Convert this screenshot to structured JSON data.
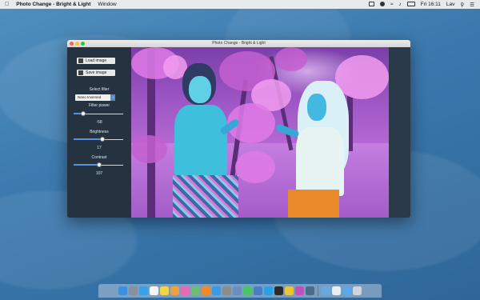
{
  "menubar": {
    "apple_icon": "apple-icon",
    "app_name": "Photo Change - Bright & Light",
    "menus": [
      "Window"
    ],
    "clock": "Fri 16:11",
    "user": "Lav"
  },
  "window": {
    "title": "Photo Change - Bright & Light"
  },
  "sidebar": {
    "load_label": "Load image",
    "save_label": "Save image",
    "select_filter_label": "Select filter",
    "filter_value": "Nano Inversed",
    "filter_power_label": "Filter power",
    "filter_power_value": "-58",
    "filter_power_level": 0.2,
    "brightness_label": "Brightness",
    "brightness_value": "17",
    "brightness_level": 0.58,
    "contrast_label": "Contrast",
    "contrast_value": "107",
    "contrast_level": 0.52
  },
  "dock": {
    "icons": [
      {
        "name": "finder-icon",
        "color": "#3f8fe0"
      },
      {
        "name": "launchpad-icon",
        "color": "#8a8fa0"
      },
      {
        "name": "safari-icon",
        "color": "#3aa0e8"
      },
      {
        "name": "calendar-icon",
        "color": "#f4f4f4"
      },
      {
        "name": "notes-icon",
        "color": "#f2d34a"
      },
      {
        "name": "photos-icon",
        "color": "#f0a040"
      },
      {
        "name": "itunes-icon",
        "color": "#e86ab0"
      },
      {
        "name": "maps-icon",
        "color": "#6ac070"
      },
      {
        "name": "books-icon",
        "color": "#f08a2a"
      },
      {
        "name": "appstore-icon",
        "color": "#3a9ae8"
      },
      {
        "name": "settings-icon",
        "color": "#8c8c8c"
      },
      {
        "name": "preview-icon",
        "color": "#6a8fc0"
      },
      {
        "name": "messages-icon",
        "color": "#4ac46a"
      },
      {
        "name": "xcode-icon",
        "color": "#4a7ec8"
      },
      {
        "name": "skype-icon",
        "color": "#2aa0e8"
      },
      {
        "name": "terminal-icon",
        "color": "#2a2a2a"
      },
      {
        "name": "chrome-icon",
        "color": "#e8c43a"
      },
      {
        "name": "photo-change-icon",
        "color": "#c050c0"
      },
      {
        "name": "monitor-icon",
        "color": "#4a6a8a"
      },
      {
        "name": "downloads-icon",
        "color": "#6aa8e0"
      },
      {
        "name": "documents-icon",
        "color": "#e8eef4"
      },
      {
        "name": "folder-icon",
        "color": "#5aa8e8"
      },
      {
        "name": "trash-icon",
        "color": "#d0d4d8"
      }
    ]
  }
}
